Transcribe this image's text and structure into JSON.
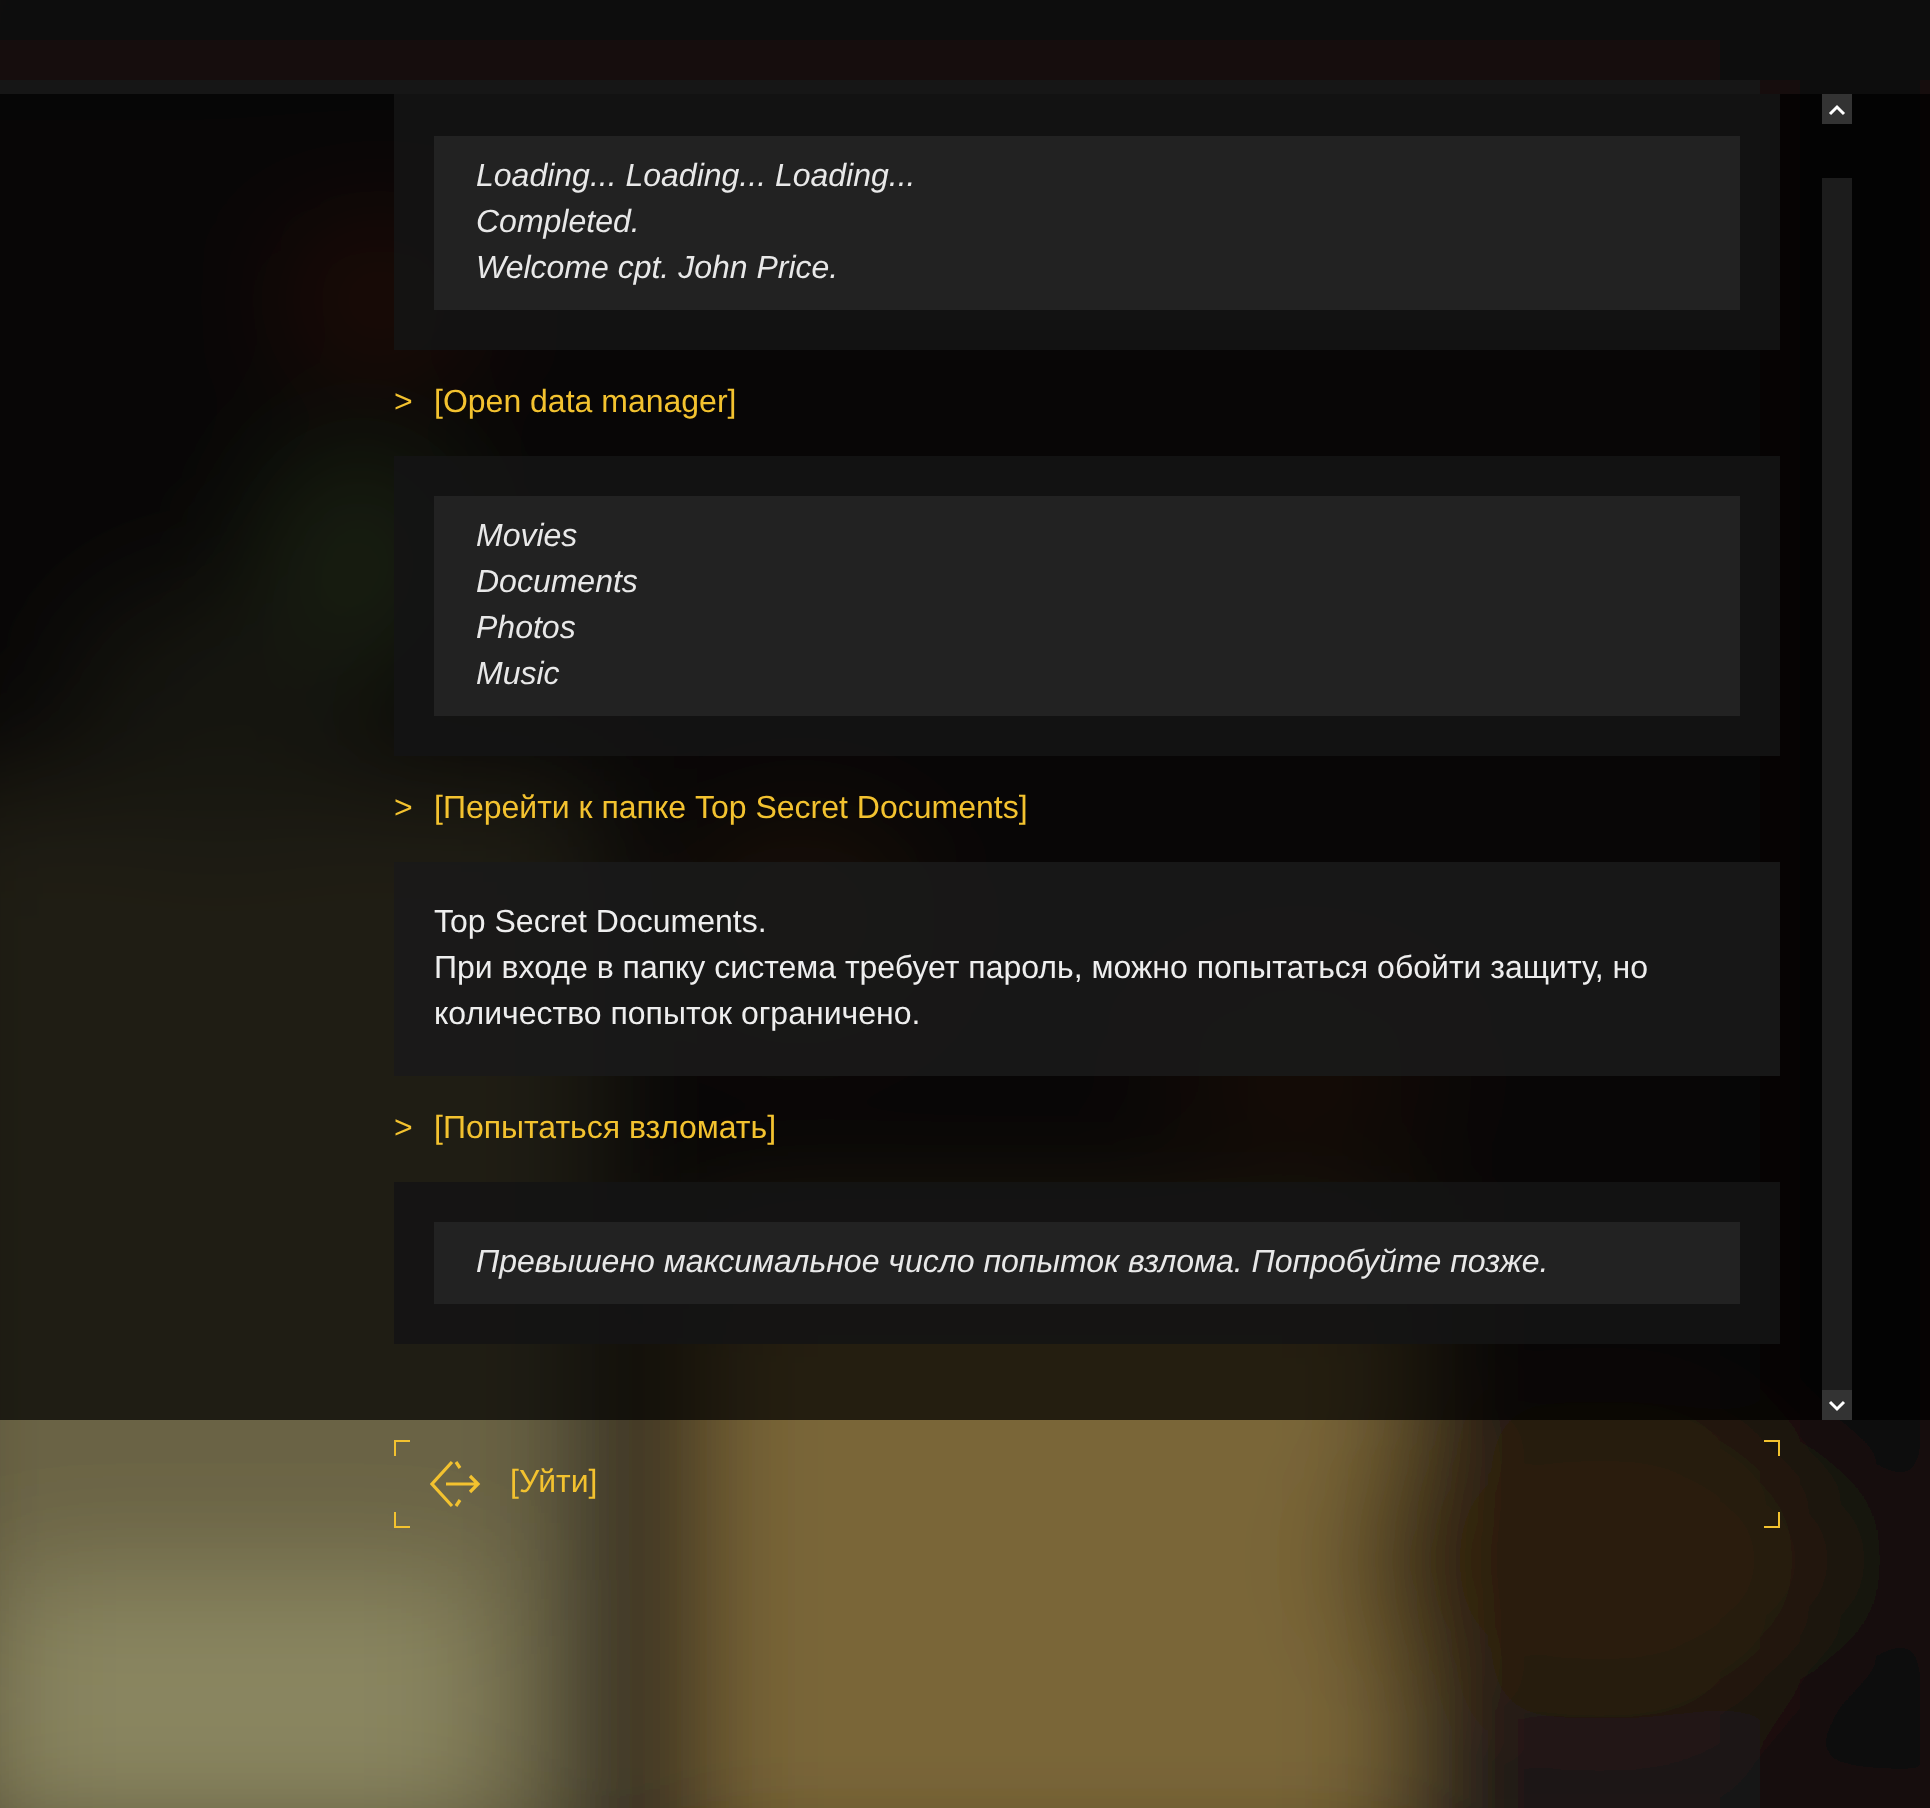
{
  "log": [
    {
      "kind": "output",
      "lines": [
        "Loading... Loading... Loading...",
        "Completed.",
        "Welcome cpt. John Price."
      ]
    },
    {
      "kind": "choice",
      "marker": ">",
      "label": "[Open data manager]"
    },
    {
      "kind": "output",
      "lines": [
        "Movies",
        "Documents",
        "Photos",
        "Music"
      ]
    },
    {
      "kind": "choice",
      "marker": ">",
      "label": "[Перейти к папке Top Secret Documents]"
    },
    {
      "kind": "description",
      "lines": [
        "Top Secret Documents.",
        "При входе в папку система требует пароль, можно попытаться обойти защиту, но количество попыток ограничено."
      ]
    },
    {
      "kind": "choice",
      "marker": ">",
      "label": "[Попытаться взломать]"
    },
    {
      "kind": "output",
      "lines": [
        "Превышено максимальное число попыток взлома. Попробуйте позже."
      ]
    }
  ],
  "exit_button": {
    "label": "[Уйти]"
  }
}
